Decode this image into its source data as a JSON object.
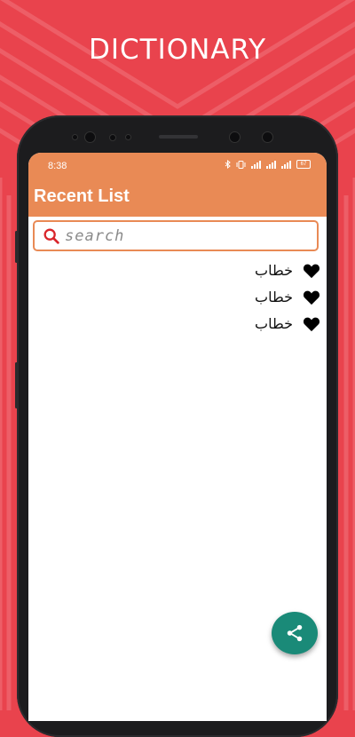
{
  "banner": {
    "title": "DICTIONARY"
  },
  "status_bar": {
    "time": "8:38",
    "battery": "67"
  },
  "app_bar": {
    "title": "Recent List"
  },
  "search": {
    "placeholder": "search",
    "value": ""
  },
  "recent_list": [
    {
      "word": "خطاب",
      "icon": "heart-icon"
    },
    {
      "word": "خطاب",
      "icon": "heart-icon"
    },
    {
      "word": "خطاب",
      "icon": "heart-icon"
    }
  ],
  "fab": {
    "icon": "share-icon"
  },
  "colors": {
    "background": "#e9434d",
    "accent": "#e98a55",
    "fab": "#1a8a78"
  }
}
